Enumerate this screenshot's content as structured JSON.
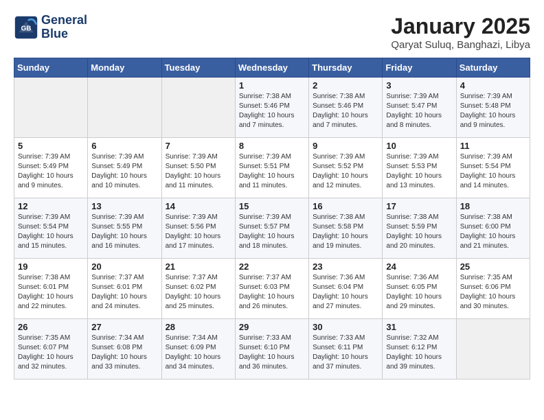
{
  "logo": {
    "name_line1": "General",
    "name_line2": "Blue"
  },
  "title": "January 2025",
  "subtitle": "Qaryat Suluq, Banghazi, Libya",
  "days_of_week": [
    "Sunday",
    "Monday",
    "Tuesday",
    "Wednesday",
    "Thursday",
    "Friday",
    "Saturday"
  ],
  "weeks": [
    [
      {
        "day": "",
        "info": ""
      },
      {
        "day": "",
        "info": ""
      },
      {
        "day": "",
        "info": ""
      },
      {
        "day": "1",
        "info": "Sunrise: 7:38 AM\nSunset: 5:46 PM\nDaylight: 10 hours and 7 minutes."
      },
      {
        "day": "2",
        "info": "Sunrise: 7:38 AM\nSunset: 5:46 PM\nDaylight: 10 hours and 7 minutes."
      },
      {
        "day": "3",
        "info": "Sunrise: 7:39 AM\nSunset: 5:47 PM\nDaylight: 10 hours and 8 minutes."
      },
      {
        "day": "4",
        "info": "Sunrise: 7:39 AM\nSunset: 5:48 PM\nDaylight: 10 hours and 9 minutes."
      }
    ],
    [
      {
        "day": "5",
        "info": "Sunrise: 7:39 AM\nSunset: 5:49 PM\nDaylight: 10 hours and 9 minutes."
      },
      {
        "day": "6",
        "info": "Sunrise: 7:39 AM\nSunset: 5:49 PM\nDaylight: 10 hours and 10 minutes."
      },
      {
        "day": "7",
        "info": "Sunrise: 7:39 AM\nSunset: 5:50 PM\nDaylight: 10 hours and 11 minutes."
      },
      {
        "day": "8",
        "info": "Sunrise: 7:39 AM\nSunset: 5:51 PM\nDaylight: 10 hours and 11 minutes."
      },
      {
        "day": "9",
        "info": "Sunrise: 7:39 AM\nSunset: 5:52 PM\nDaylight: 10 hours and 12 minutes."
      },
      {
        "day": "10",
        "info": "Sunrise: 7:39 AM\nSunset: 5:53 PM\nDaylight: 10 hours and 13 minutes."
      },
      {
        "day": "11",
        "info": "Sunrise: 7:39 AM\nSunset: 5:54 PM\nDaylight: 10 hours and 14 minutes."
      }
    ],
    [
      {
        "day": "12",
        "info": "Sunrise: 7:39 AM\nSunset: 5:54 PM\nDaylight: 10 hours and 15 minutes."
      },
      {
        "day": "13",
        "info": "Sunrise: 7:39 AM\nSunset: 5:55 PM\nDaylight: 10 hours and 16 minutes."
      },
      {
        "day": "14",
        "info": "Sunrise: 7:39 AM\nSunset: 5:56 PM\nDaylight: 10 hours and 17 minutes."
      },
      {
        "day": "15",
        "info": "Sunrise: 7:39 AM\nSunset: 5:57 PM\nDaylight: 10 hours and 18 minutes."
      },
      {
        "day": "16",
        "info": "Sunrise: 7:38 AM\nSunset: 5:58 PM\nDaylight: 10 hours and 19 minutes."
      },
      {
        "day": "17",
        "info": "Sunrise: 7:38 AM\nSunset: 5:59 PM\nDaylight: 10 hours and 20 minutes."
      },
      {
        "day": "18",
        "info": "Sunrise: 7:38 AM\nSunset: 6:00 PM\nDaylight: 10 hours and 21 minutes."
      }
    ],
    [
      {
        "day": "19",
        "info": "Sunrise: 7:38 AM\nSunset: 6:01 PM\nDaylight: 10 hours and 22 minutes."
      },
      {
        "day": "20",
        "info": "Sunrise: 7:37 AM\nSunset: 6:01 PM\nDaylight: 10 hours and 24 minutes."
      },
      {
        "day": "21",
        "info": "Sunrise: 7:37 AM\nSunset: 6:02 PM\nDaylight: 10 hours and 25 minutes."
      },
      {
        "day": "22",
        "info": "Sunrise: 7:37 AM\nSunset: 6:03 PM\nDaylight: 10 hours and 26 minutes."
      },
      {
        "day": "23",
        "info": "Sunrise: 7:36 AM\nSunset: 6:04 PM\nDaylight: 10 hours and 27 minutes."
      },
      {
        "day": "24",
        "info": "Sunrise: 7:36 AM\nSunset: 6:05 PM\nDaylight: 10 hours and 29 minutes."
      },
      {
        "day": "25",
        "info": "Sunrise: 7:35 AM\nSunset: 6:06 PM\nDaylight: 10 hours and 30 minutes."
      }
    ],
    [
      {
        "day": "26",
        "info": "Sunrise: 7:35 AM\nSunset: 6:07 PM\nDaylight: 10 hours and 32 minutes."
      },
      {
        "day": "27",
        "info": "Sunrise: 7:34 AM\nSunset: 6:08 PM\nDaylight: 10 hours and 33 minutes."
      },
      {
        "day": "28",
        "info": "Sunrise: 7:34 AM\nSunset: 6:09 PM\nDaylight: 10 hours and 34 minutes."
      },
      {
        "day": "29",
        "info": "Sunrise: 7:33 AM\nSunset: 6:10 PM\nDaylight: 10 hours and 36 minutes."
      },
      {
        "day": "30",
        "info": "Sunrise: 7:33 AM\nSunset: 6:11 PM\nDaylight: 10 hours and 37 minutes."
      },
      {
        "day": "31",
        "info": "Sunrise: 7:32 AM\nSunset: 6:12 PM\nDaylight: 10 hours and 39 minutes."
      },
      {
        "day": "",
        "info": ""
      }
    ]
  ]
}
